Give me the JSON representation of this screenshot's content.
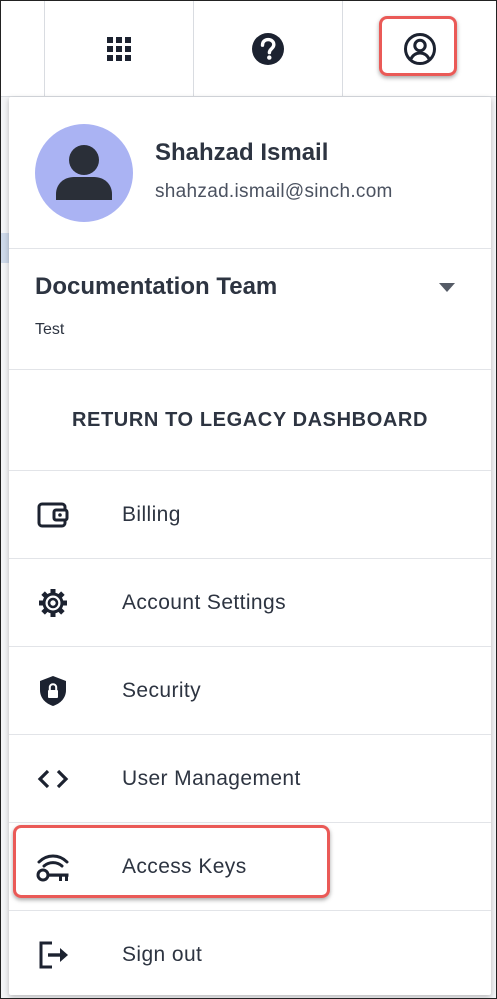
{
  "topbar": {
    "apps_icon": "apps-grid-icon",
    "help_icon": "help-circle-icon",
    "user_icon": "user-account-icon"
  },
  "profile": {
    "name": "Shahzad Ismail",
    "email": "shahzad.ismail@sinch.com",
    "avatar_icon": "person-avatar-icon"
  },
  "team": {
    "name": "Documentation Team",
    "subtitle": "Test",
    "dropdown_icon": "caret-down-icon"
  },
  "legacy_link": "RETURN TO LEGACY DASHBOARD",
  "menu": {
    "items": [
      {
        "label": "Billing",
        "icon": "wallet-icon"
      },
      {
        "label": "Account Settings",
        "icon": "gear-icon"
      },
      {
        "label": "Security",
        "icon": "shield-lock-icon"
      },
      {
        "label": "User Management",
        "icon": "code-brackets-icon"
      },
      {
        "label": "Access Keys",
        "icon": "key-icon"
      },
      {
        "label": "Sign out",
        "icon": "sign-out-icon"
      }
    ]
  },
  "colors": {
    "highlight": "#ea5a57",
    "avatar_bg": "#aab3f3",
    "text": "#2d3441",
    "icon": "#1c2230"
  }
}
